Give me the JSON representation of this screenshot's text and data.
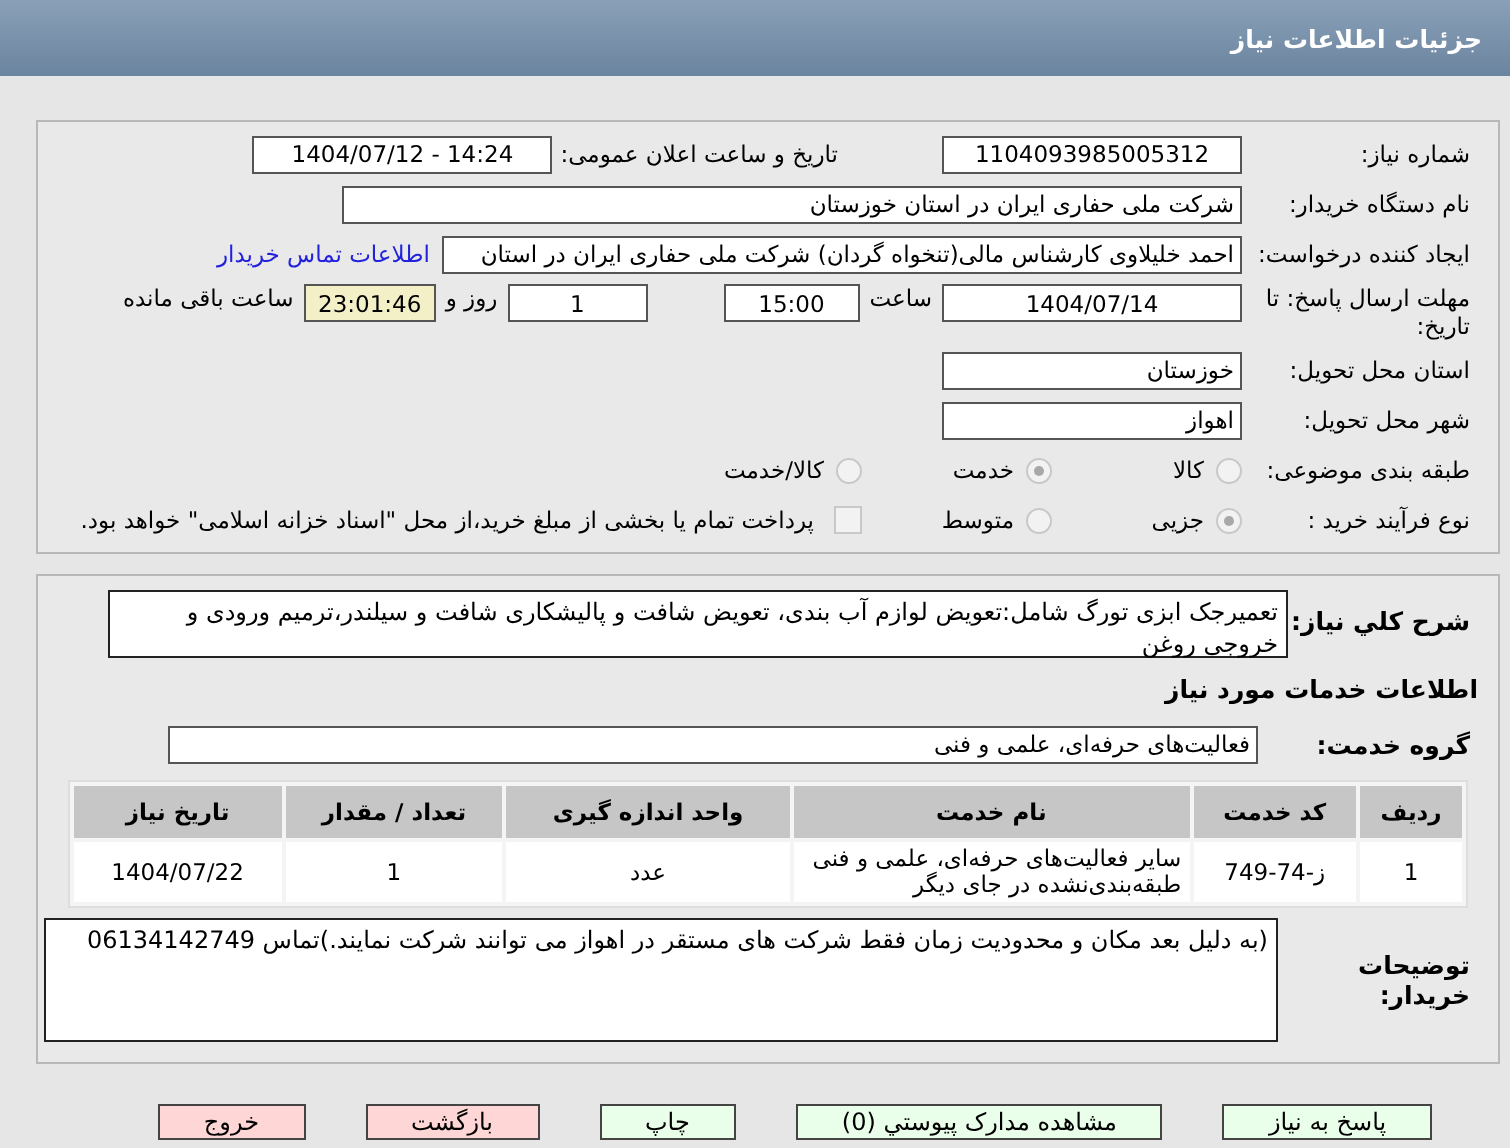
{
  "header": {
    "title": "جزئیات اطلاعات نیاز"
  },
  "need_number": {
    "label": "شماره نیاز:",
    "value": "1104093985005312"
  },
  "announce": {
    "label": "تاریخ و ساعت اعلان عمومی:",
    "value": "1404/07/12 - 14:24"
  },
  "buyer_org": {
    "label": "نام دستگاه خریدار:",
    "value": "شرکت ملی حفاری ایران در استان خوزستان"
  },
  "requester": {
    "label": "ایجاد کننده درخواست:",
    "value": "احمد خلیلاوی کارشناس مالی(تنخواه گردان) شرکت ملی حفاری ایران در استان",
    "link": "اطلاعات تماس خریدار"
  },
  "deadline": {
    "label": "مهلت ارسال پاسخ: تا تاریخ:",
    "date": "1404/07/14",
    "time_label": "ساعت",
    "time": "15:00",
    "days": "1",
    "days_label": "روز و",
    "remaining": "23:01:46",
    "remaining_label": "ساعت باقی مانده"
  },
  "province": {
    "label": "استان محل تحویل:",
    "value": "خوزستان"
  },
  "city": {
    "label": "شهر محل تحویل:",
    "value": "اهواز"
  },
  "category": {
    "label": "طبقه بندی موضوعی:",
    "options": [
      {
        "label": "کالا",
        "selected": false
      },
      {
        "label": "خدمت",
        "selected": true
      },
      {
        "label": "کالا/خدمت",
        "selected": false
      }
    ]
  },
  "purchase_process": {
    "label": "نوع فرآیند خرید :",
    "options": [
      {
        "label": "جزیی",
        "selected": true
      },
      {
        "label": "متوسط",
        "selected": false
      }
    ],
    "payment": {
      "label": "پرداخت تمام یا بخشی از مبلغ خرید،از محل \"اسناد خزانه اسلامی\" خواهد بود.",
      "checked": false
    }
  },
  "description": {
    "label": "شرح کلي نیاز:",
    "value": "تعمیرجک ابزی تورگ شامل:تعویض لوازم آب بندی، تعویض شافت و پالیشکاری شافت و سیلندر،ترمیم ورودی و خروجی روغن"
  },
  "services_title": "اطلاعات خدمات مورد نیاز",
  "service_group": {
    "label": "گروه خدمت:",
    "value": "فعالیت‌های حرفه‌ای، علمی و فنی"
  },
  "table": {
    "columns": [
      "ردیف",
      "کد خدمت",
      "نام خدمت",
      "واحد اندازه گیری",
      "تعداد / مقدار",
      "تاریخ نیاز"
    ],
    "rows": [
      [
        "1",
        "ز-74-749",
        "سایر فعالیت‌های حرفه‌ای، علمی و فنی طبقه‌بندی‌نشده در جای دیگر",
        "عدد",
        "1",
        "1404/07/22"
      ]
    ]
  },
  "buyer_notes": {
    "label": "توضیحات خریدار:",
    "value": "(به دلیل بعد مکان و محدودیت زمان فقط شرکت های مستقر در اهواز می توانند شرکت نمایند.)تماس 06134142749"
  },
  "buttons": [
    {
      "label": "پاسخ به نیاز",
      "kind": "action"
    },
    {
      "label": "مشاهده مدارک پیوستي (0)",
      "kind": "action"
    },
    {
      "label": "چاپ",
      "kind": "action"
    },
    {
      "label": "بازگشت",
      "kind": "exit"
    },
    {
      "label": "خروج",
      "kind": "exit"
    }
  ]
}
